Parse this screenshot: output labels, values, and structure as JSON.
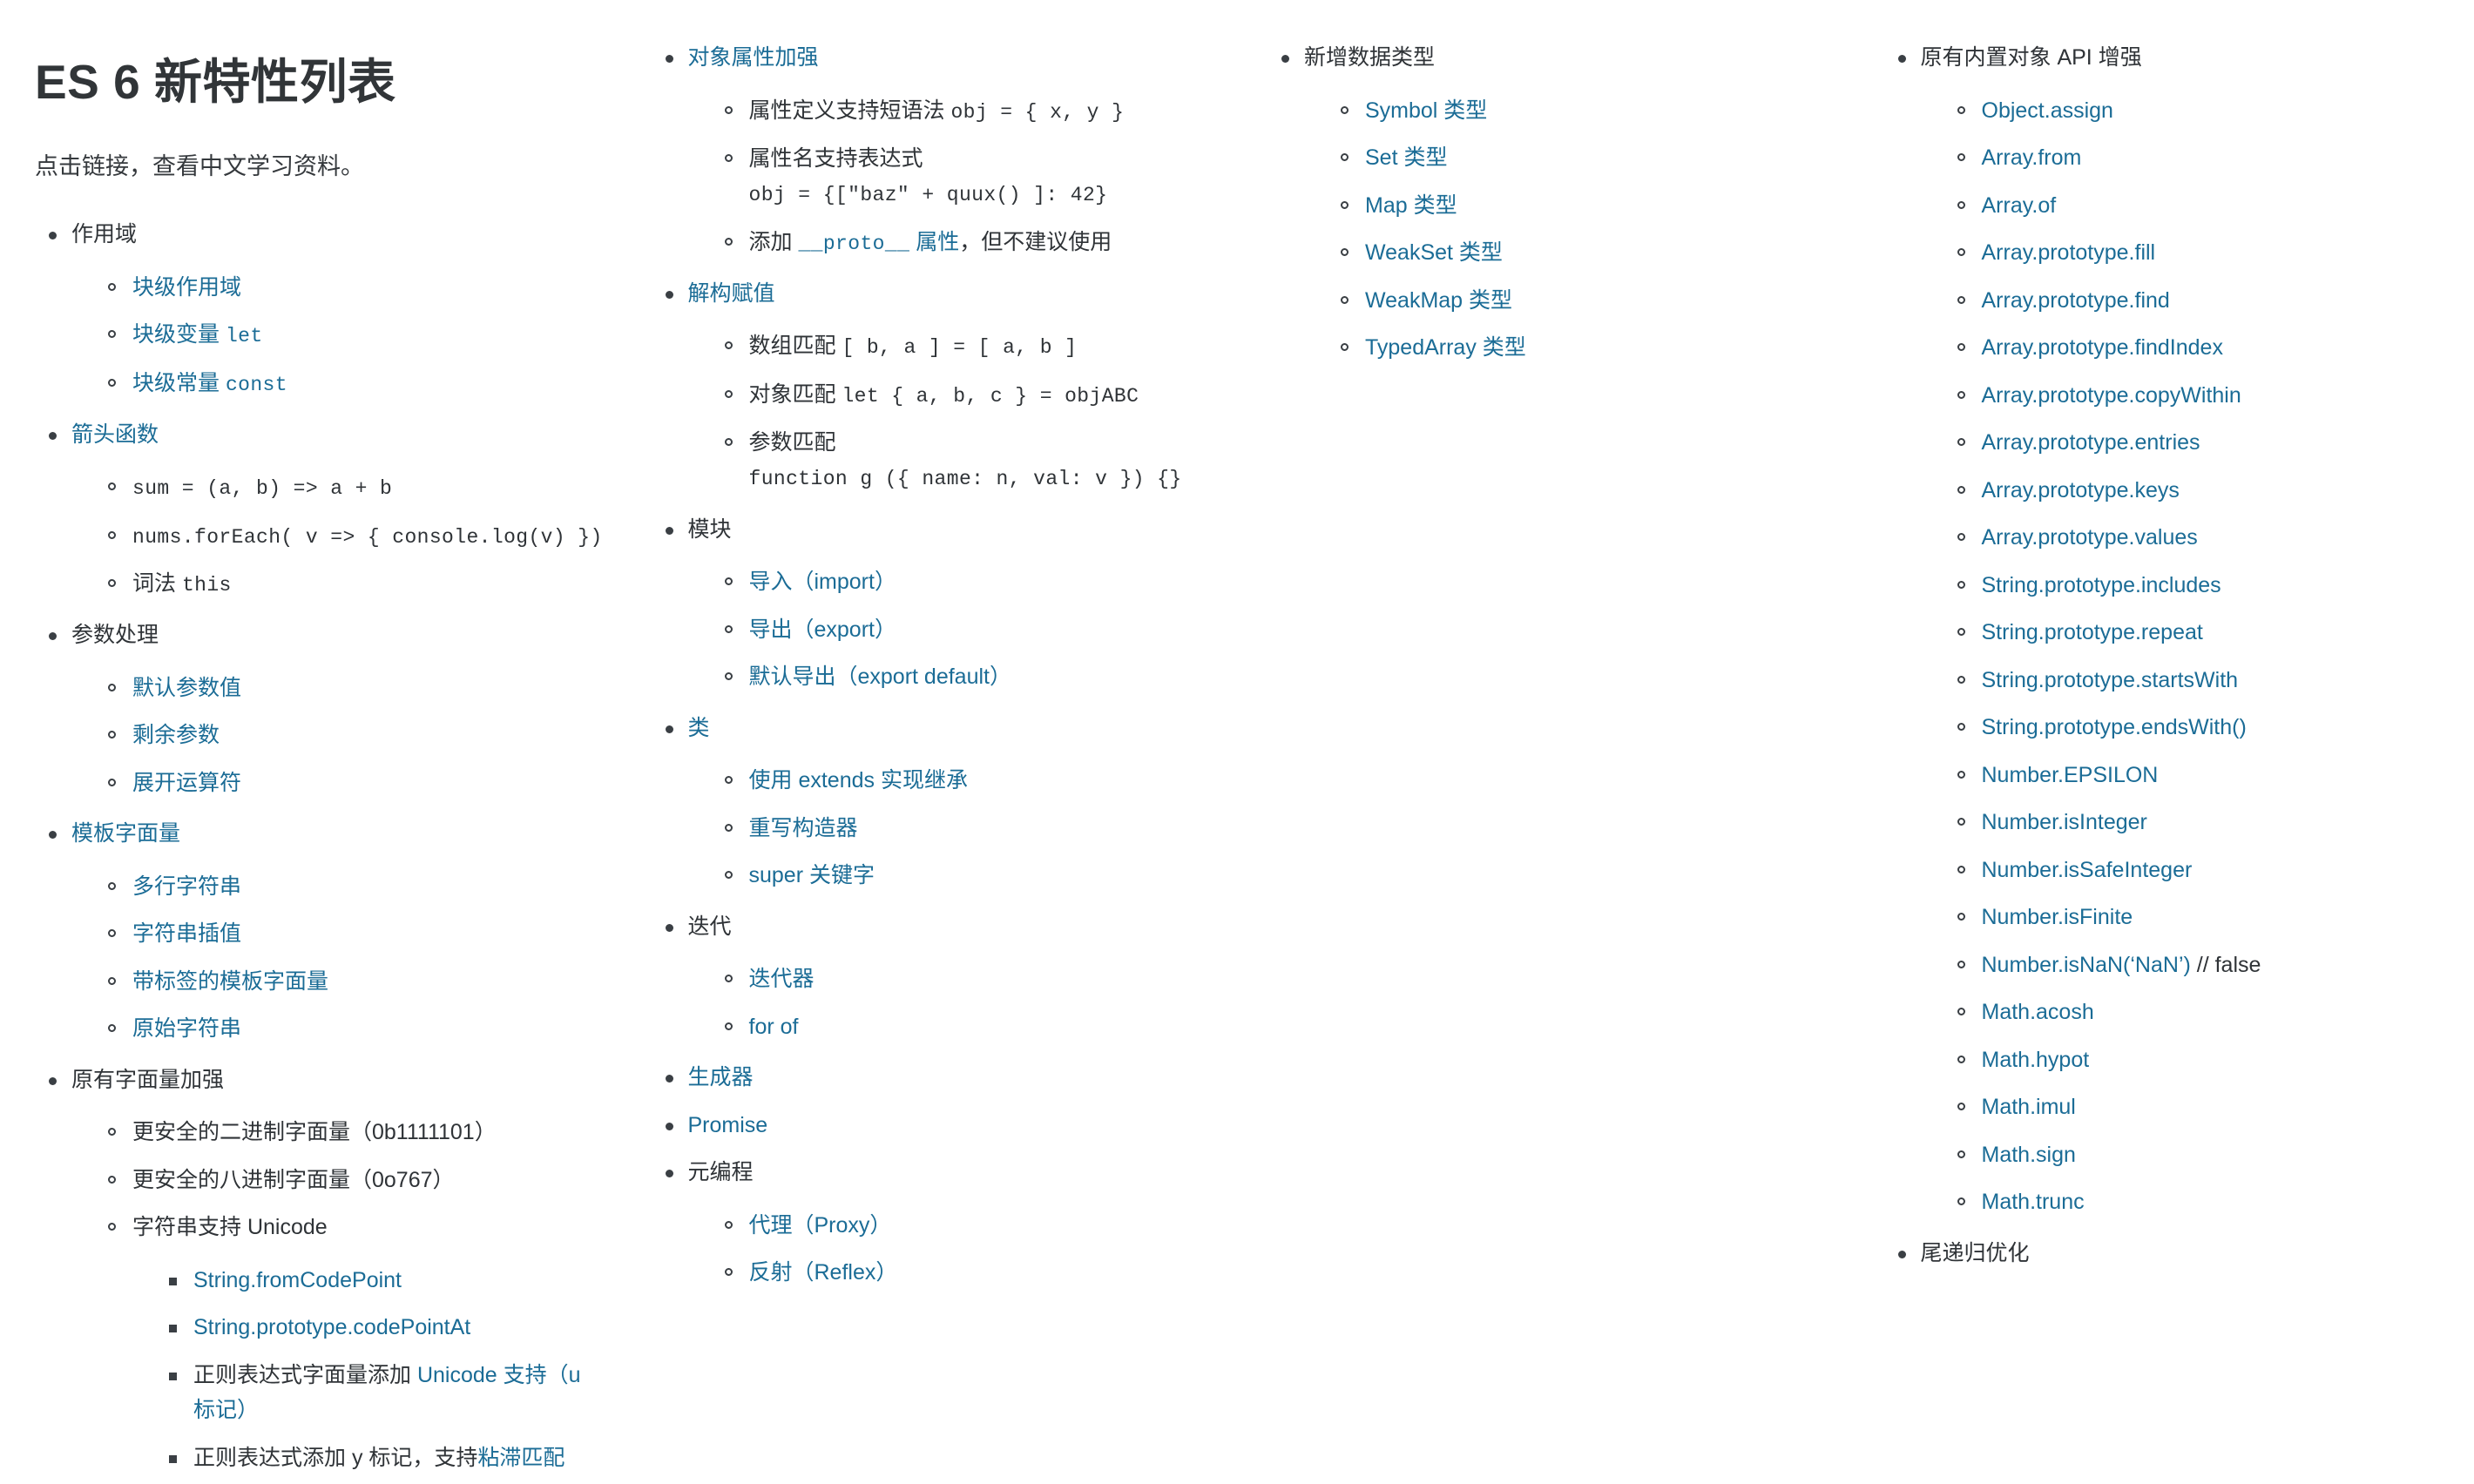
{
  "header": {
    "title": "ES 6 新特性列表",
    "subtitle": "点击链接，查看中文学习资料。"
  },
  "colors": {
    "link": "#1b6c96",
    "text": "#2f3337",
    "title": "#313538",
    "background": "#ffffff"
  },
  "sections": [
    {
      "label": "作用域",
      "style": "plain",
      "children": [
        {
          "label": "块级作用域",
          "style": "link"
        },
        {
          "label": "块级变量 ",
          "style": "link",
          "code": "let"
        },
        {
          "label": "块级常量 ",
          "style": "link",
          "code": "const"
        }
      ]
    },
    {
      "label": "箭头函数",
      "style": "link",
      "children": [
        {
          "label": "",
          "style": "plain",
          "code": "sum = (a, b) => a + b"
        },
        {
          "label": "",
          "style": "plain",
          "code": "nums.forEach( v => { console.log(v) })"
        },
        {
          "label": "词法 ",
          "style": "plain",
          "code": "this"
        }
      ]
    },
    {
      "label": "参数处理",
      "style": "plain",
      "children": [
        {
          "label": "默认参数值",
          "style": "link"
        },
        {
          "label": "剩余参数",
          "style": "link"
        },
        {
          "label": "展开运算符",
          "style": "link"
        }
      ]
    },
    {
      "label": "模板字面量",
      "style": "link",
      "children": [
        {
          "label": "多行字符串",
          "style": "link"
        },
        {
          "label": "字符串插值",
          "style": "link"
        },
        {
          "label": "带标签的模板字面量",
          "style": "link"
        },
        {
          "label": "原始字符串",
          "style": "link"
        }
      ]
    },
    {
      "label": "原有字面量加强",
      "style": "plain",
      "children": [
        {
          "label": "更安全的二进制字面量（0b1111101）",
          "style": "plain"
        },
        {
          "label": "更安全的八进制字面量（0o767）",
          "style": "plain"
        },
        {
          "label": "字符串支持 Unicode",
          "style": "plain",
          "children": [
            {
              "label": "String.fromCodePoint",
              "style": "link"
            },
            {
              "label": "String.prototype.codePointAt",
              "style": "link"
            },
            {
              "label": "正则表达式字面量添加 ",
              "style": "plain",
              "link_tail": "Unicode 支持（u 标记）"
            },
            {
              "label": "正则表达式添加 y 标记，支持",
              "style": "plain",
              "link_tail": "粘滞匹配"
            }
          ]
        }
      ]
    },
    {
      "label": "对象属性加强",
      "style": "link",
      "children": [
        {
          "label": "属性定义支持短语法 ",
          "style": "plain",
          "code": "obj = { x, y }"
        },
        {
          "label": "属性名支持表达式 ",
          "style": "plain",
          "code": "obj = {[\"baz\" + quux() ]: 42}"
        },
        {
          "label": "添加 ",
          "style": "plain",
          "link_code": "__proto__",
          "link_tail": " 属性",
          "tail": "，但不建议使用"
        }
      ]
    },
    {
      "label": "解构赋值",
      "style": "link",
      "children": [
        {
          "label": "数组匹配 ",
          "style": "plain",
          "code": "[ b, a ] = [ a, b ]"
        },
        {
          "label": "对象匹配 ",
          "style": "plain",
          "code": "let { a, b, c } = objABC"
        },
        {
          "label": "参数匹配 ",
          "style": "plain",
          "code": "function g ({ name: n, val: v }) {}"
        }
      ]
    },
    {
      "label": "模块",
      "style": "plain",
      "children": [
        {
          "label": "导入（import）",
          "style": "link"
        },
        {
          "label": "导出（export）",
          "style": "link"
        },
        {
          "label": "默认导出（export default）",
          "style": "link"
        }
      ]
    },
    {
      "label": "类",
      "style": "link",
      "children": [
        {
          "label": "使用 extends 实现继承",
          "style": "link"
        },
        {
          "label": "重写构造器",
          "style": "link"
        },
        {
          "label": "super 关键字",
          "style": "link"
        }
      ]
    },
    {
      "label": "迭代",
      "style": "plain",
      "children": [
        {
          "label": "迭代器",
          "style": "link"
        },
        {
          "label": "for of",
          "style": "link"
        }
      ]
    },
    {
      "label": "生成器",
      "style": "link",
      "children": []
    },
    {
      "label": "Promise",
      "style": "link",
      "children": []
    },
    {
      "label": "元编程",
      "style": "plain",
      "children": [
        {
          "label": "代理（Proxy）",
          "style": "link"
        },
        {
          "label": "反射（Reflex）",
          "style": "link"
        }
      ]
    },
    {
      "label": "新增数据类型",
      "style": "plain",
      "children": [
        {
          "label": "Symbol 类型",
          "style": "link"
        },
        {
          "label": "Set 类型",
          "style": "link"
        },
        {
          "label": "Map 类型",
          "style": "link"
        },
        {
          "label": "WeakSet 类型",
          "style": "link"
        },
        {
          "label": "WeakMap 类型",
          "style": "link"
        },
        {
          "label": "TypedArray 类型",
          "style": "link"
        }
      ]
    },
    {
      "label": "原有内置对象 API 增强",
      "style": "plain",
      "children": [
        {
          "label": "Object.assign",
          "style": "link"
        },
        {
          "label": "Array.from",
          "style": "link"
        },
        {
          "label": "Array.of",
          "style": "link"
        },
        {
          "label": "Array.prototype.fill",
          "style": "link"
        },
        {
          "label": "Array.prototype.find",
          "style": "link"
        },
        {
          "label": "Array.prototype.findIndex",
          "style": "link"
        },
        {
          "label": "Array.prototype.copyWithin",
          "style": "link"
        },
        {
          "label": "Array.prototype.entries",
          "style": "link"
        },
        {
          "label": "Array.prototype.keys",
          "style": "link"
        },
        {
          "label": "Array.prototype.values",
          "style": "link"
        },
        {
          "label": "String.prototype.includes",
          "style": "link"
        },
        {
          "label": "String.prototype.repeat",
          "style": "link"
        },
        {
          "label": "String.prototype.startsWith",
          "style": "link"
        },
        {
          "label": "String.prototype.endsWith()",
          "style": "link"
        },
        {
          "label": "Number.EPSILON",
          "style": "link"
        },
        {
          "label": "Number.isInteger",
          "style": "link"
        },
        {
          "label": "Number.isSafeInteger",
          "style": "link"
        },
        {
          "label": "Number.isFinite",
          "style": "link"
        },
        {
          "label": "Number.isNaN(‘NaN’)",
          "style": "link",
          "tail": " // false"
        },
        {
          "label": "Math.acosh",
          "style": "link"
        },
        {
          "label": "Math.hypot",
          "style": "link"
        },
        {
          "label": "Math.imul",
          "style": "link"
        },
        {
          "label": "Math.sign",
          "style": "link"
        },
        {
          "label": "Math.trunc",
          "style": "link"
        }
      ]
    },
    {
      "label": "尾递归优化",
      "style": "plain",
      "children": []
    }
  ]
}
